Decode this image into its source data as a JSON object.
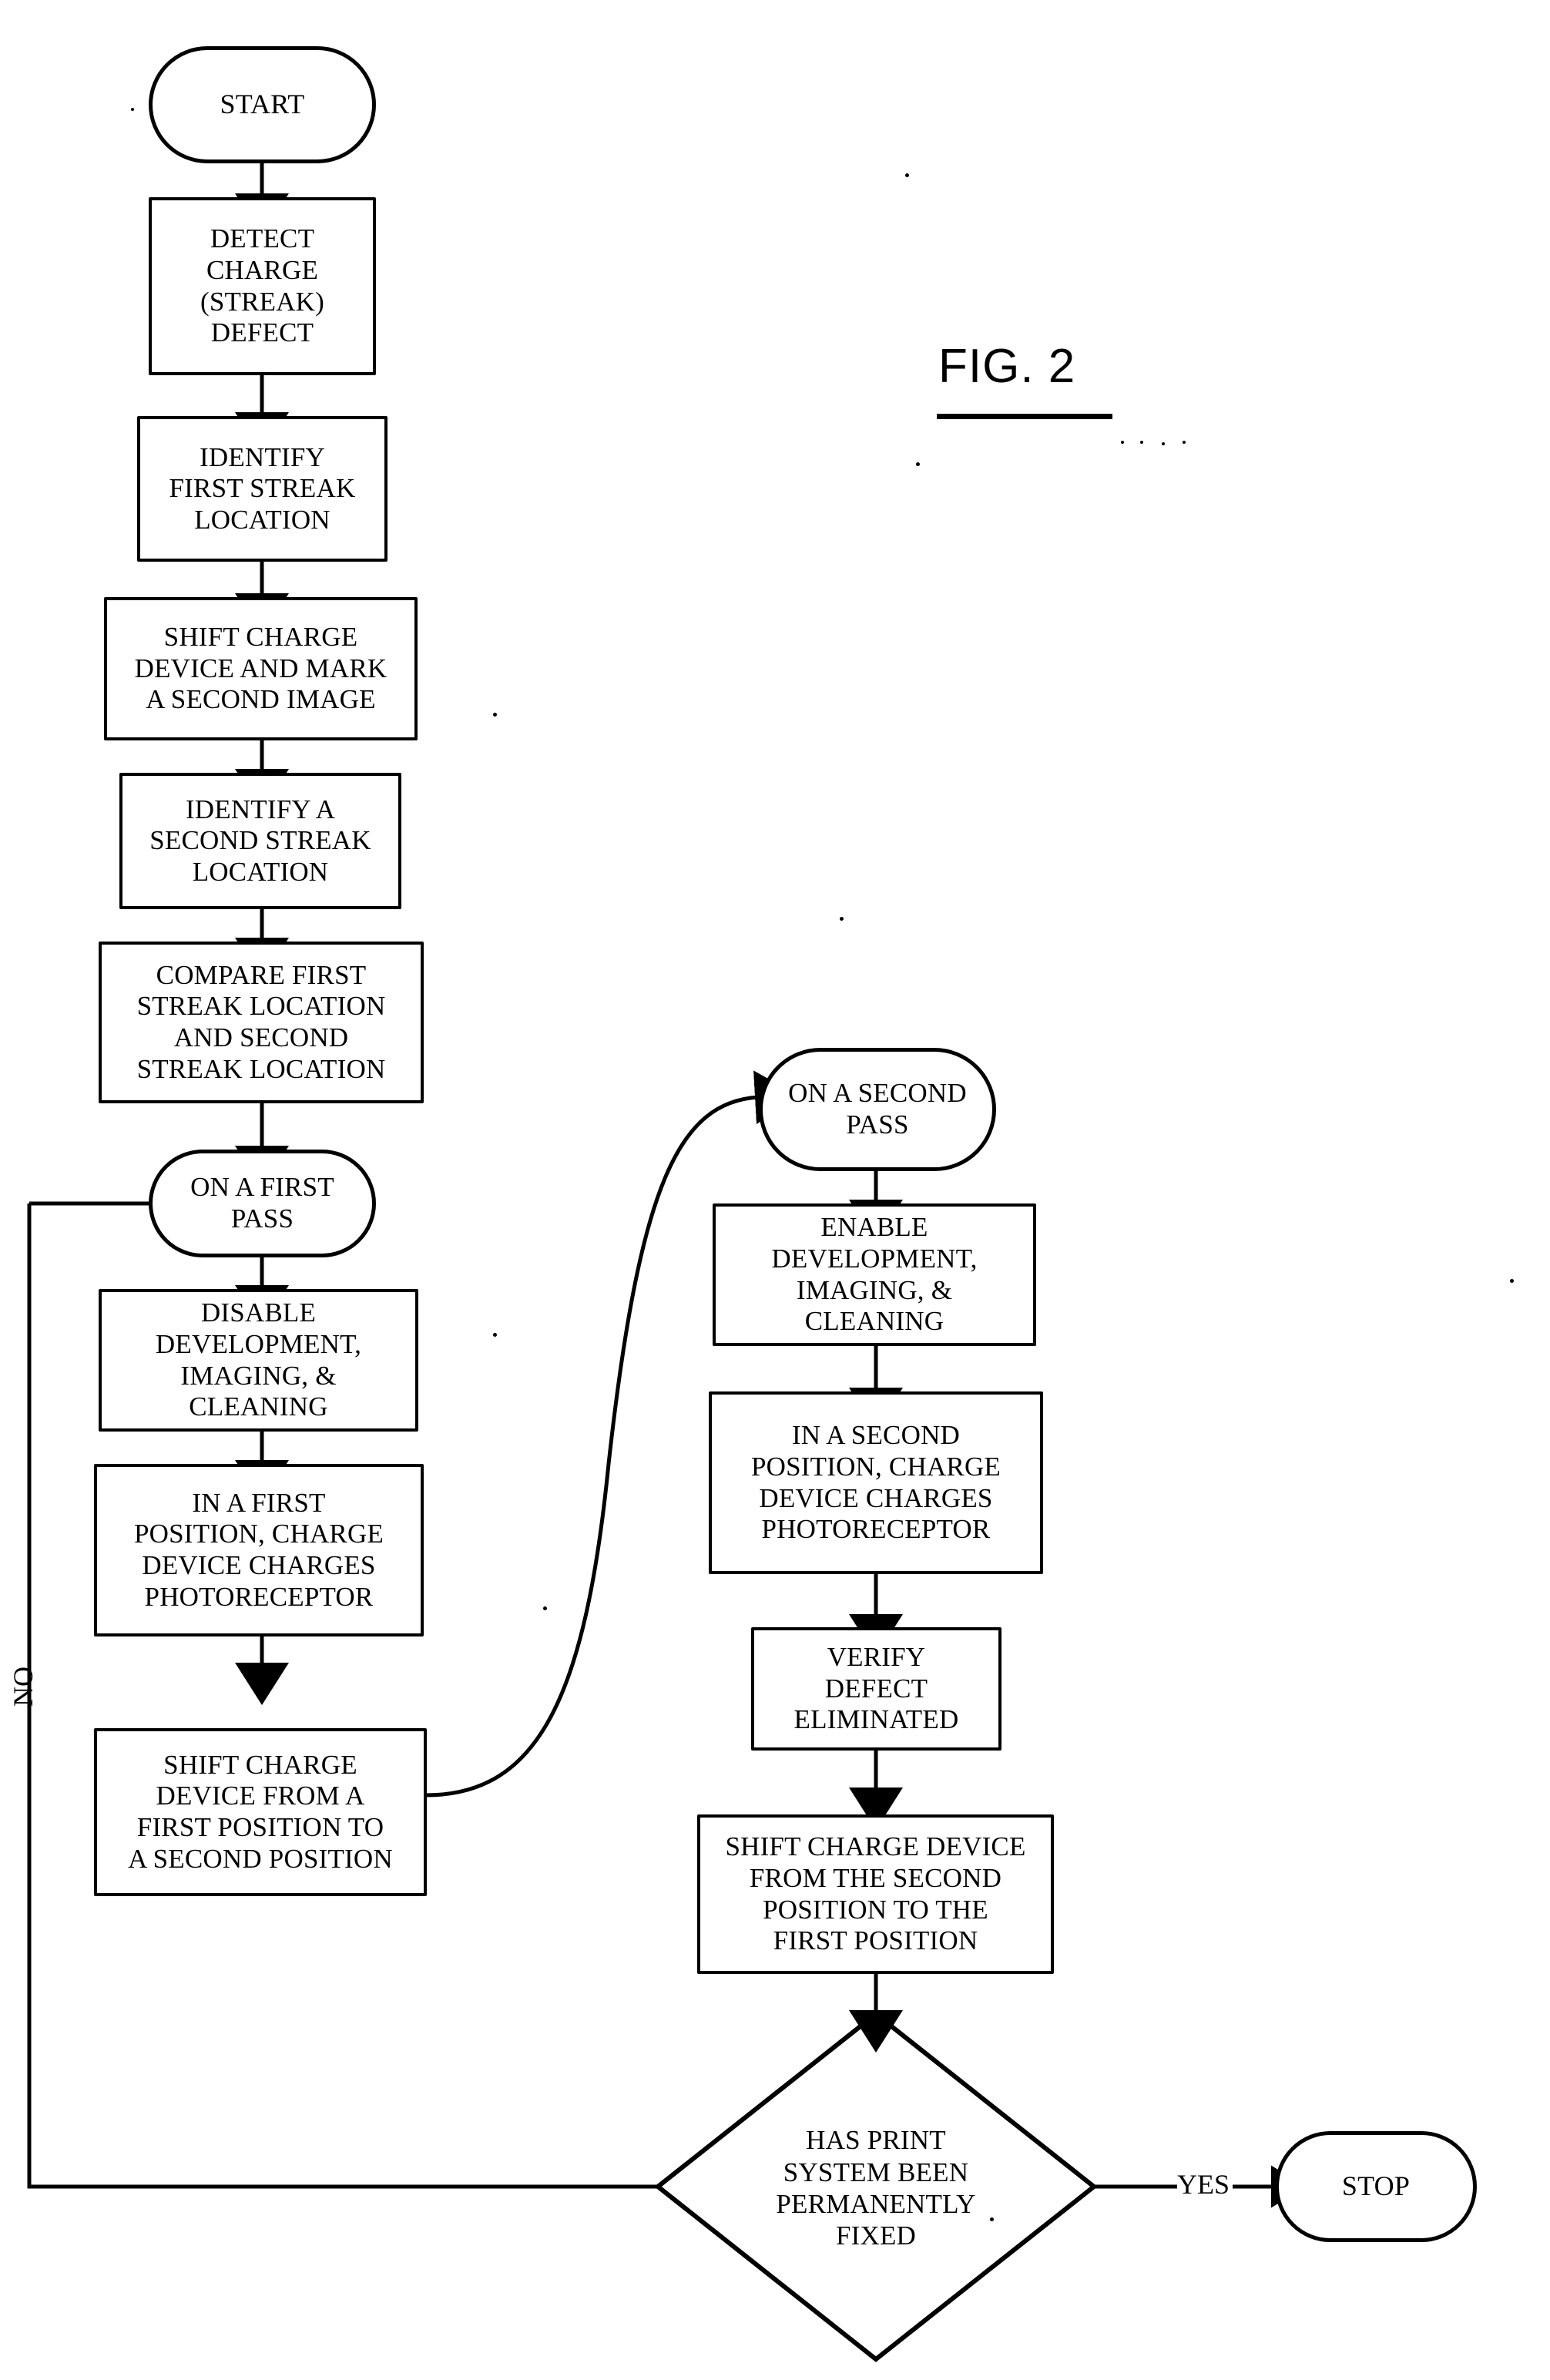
{
  "figure": {
    "label": "FIG. 2",
    "type": "flowchart",
    "orientation": "two-column vertical"
  },
  "nodes": [
    {
      "id": "start",
      "shape": "terminal",
      "text": "START"
    },
    {
      "id": "detect",
      "shape": "process",
      "text": "DETECT\nCHARGE\n(STREAK)\nDEFECT"
    },
    {
      "id": "identify1",
      "shape": "process",
      "text": "IDENTIFY\nFIRST STREAK\nLOCATION"
    },
    {
      "id": "shiftmark",
      "shape": "process",
      "text": "SHIFT CHARGE\nDEVICE AND MARK\nA SECOND IMAGE"
    },
    {
      "id": "identify2",
      "shape": "process",
      "text": "IDENTIFY A\nSECOND STREAK\nLOCATION"
    },
    {
      "id": "compare",
      "shape": "process",
      "text": "COMPARE FIRST\nSTREAK LOCATION\nAND SECOND\nSTREAK LOCATION"
    },
    {
      "id": "firstpass",
      "shape": "terminal",
      "text": "ON A FIRST\nPASS"
    },
    {
      "id": "disable",
      "shape": "process",
      "text": "DISABLE\nDEVELOPMENT,\nIMAGING, &\nCLEANING"
    },
    {
      "id": "firstpos",
      "shape": "process",
      "text": "IN A FIRST\nPOSITION, CHARGE\nDEVICE CHARGES\nPHOTORECEPTOR"
    },
    {
      "id": "shift1to2",
      "shape": "process",
      "text": "SHIFT CHARGE\nDEVICE FROM A\nFIRST POSITION TO\nA SECOND POSITION"
    },
    {
      "id": "secondpass",
      "shape": "terminal",
      "text": "ON A SECOND\nPASS"
    },
    {
      "id": "enable",
      "shape": "process",
      "text": "ENABLE\nDEVELOPMENT,\nIMAGING, &\nCLEANING"
    },
    {
      "id": "secondpos",
      "shape": "process",
      "text": "IN A SECOND\nPOSITION, CHARGE\nDEVICE CHARGES\nPHOTORECEPTOR"
    },
    {
      "id": "verify",
      "shape": "process",
      "text": "VERIFY\nDEFECT\nELIMINATED"
    },
    {
      "id": "shift2to1",
      "shape": "process",
      "text": "SHIFT CHARGE DEVICE\nFROM THE SECOND\nPOSITION TO THE\nFIRST POSITION"
    },
    {
      "id": "decision",
      "shape": "decision",
      "text": "HAS PRINT\nSYSTEM BEEN\nPERMANENTLY\nFIXED"
    },
    {
      "id": "stop",
      "shape": "terminal",
      "text": "STOP"
    }
  ],
  "edge_labels": {
    "no": "NO",
    "yes": "YES"
  },
  "colors": {
    "ink": "#000000",
    "paper": "#ffffff"
  }
}
